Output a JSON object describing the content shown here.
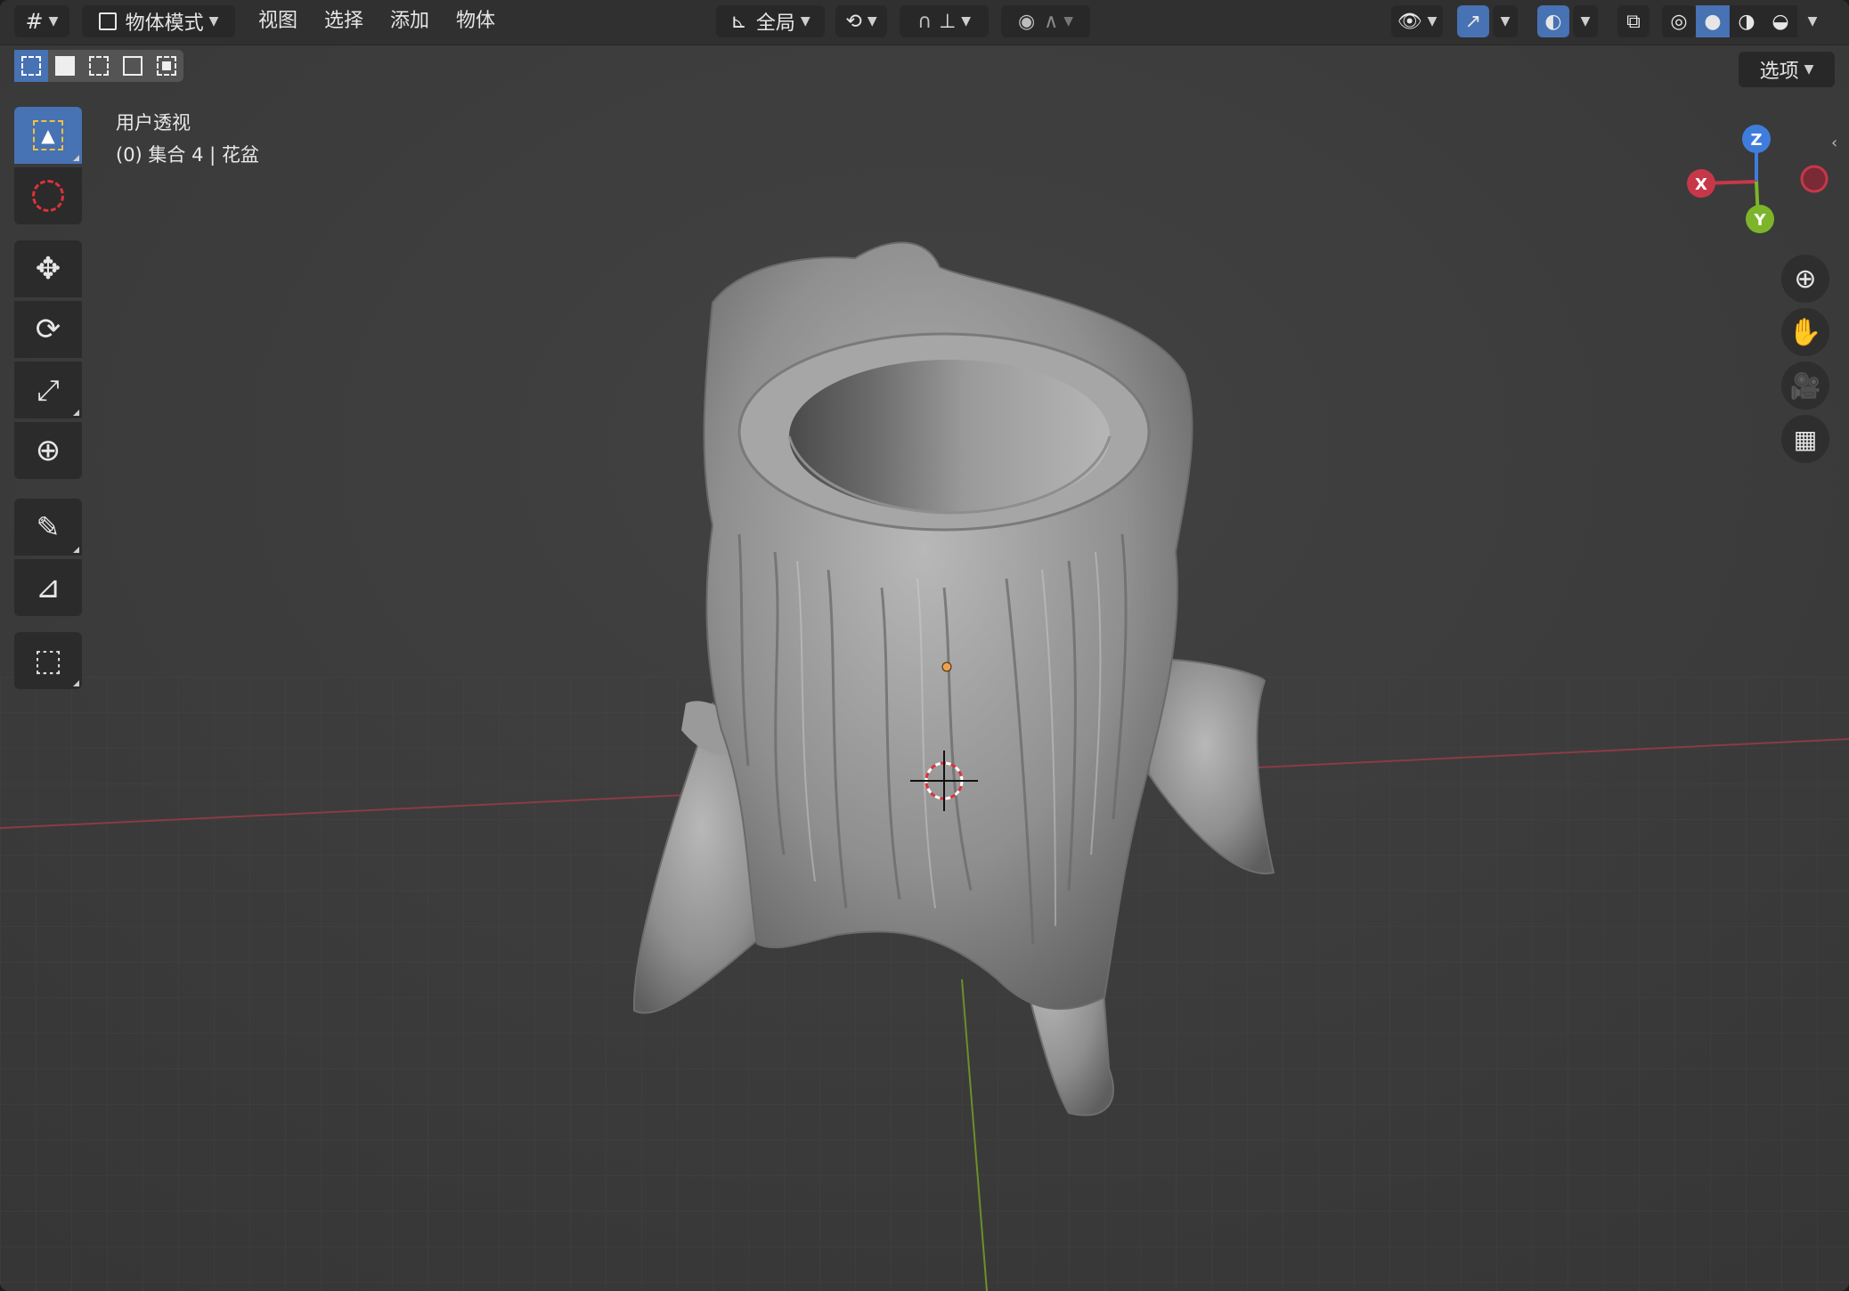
{
  "header": {
    "editor_type_icon": "grid-icon",
    "mode_label": "物体模式",
    "menus": [
      "视图",
      "选择",
      "添加",
      "物体"
    ],
    "transform_orientation": "全局"
  },
  "options_label": "选项",
  "overlay": {
    "view_name": "用户透视",
    "collection_info": "(0) 集合 4 | 花盆"
  },
  "gizmo": {
    "z": "Z",
    "x": "X",
    "y": "Y"
  },
  "tools": [
    "select-box-icon",
    "cursor-icon",
    "move-icon",
    "rotate-icon",
    "scale-icon",
    "transform-icon",
    "annotate-icon",
    "measure-icon",
    "add-cube-icon"
  ],
  "colors": {
    "accent": "#4772b3",
    "axis_x": "#c7374a",
    "axis_y": "#7cb52a",
    "axis_z": "#3f7ddc"
  }
}
